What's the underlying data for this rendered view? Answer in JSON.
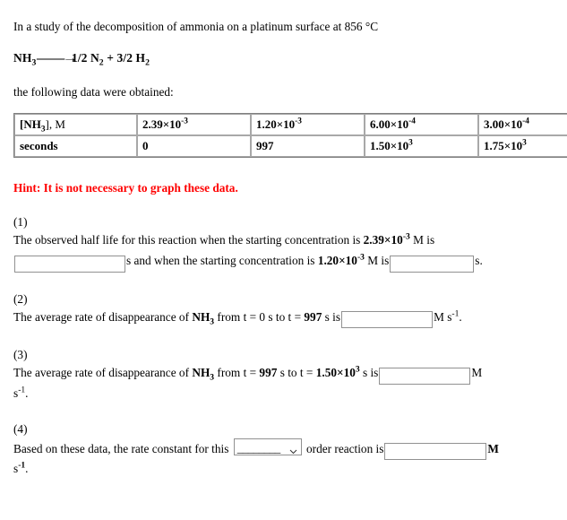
{
  "problem": {
    "intro": "In a study of the decomposition of ammonia on a platinum surface at 856 °C",
    "equation": {
      "reactant": "NH",
      "reactant_sub": "3",
      "arrow": "——→",
      "product_1_coef": "1/2 N",
      "product_1_sub": "2",
      "plus": " + ",
      "product_2_coef": "3/2 H",
      "product_2_sub": "2"
    },
    "lead_in": "the following data were obtained:",
    "hint": "Hint: It is not necessary to graph these data."
  },
  "table": {
    "rows": [
      {
        "label": "[NH",
        "label_sub": "3",
        "label_rest": "], M",
        "values": [
          {
            "mantissa": "2.39×10",
            "exp": "-3"
          },
          {
            "mantissa": "1.20×10",
            "exp": "-3"
          },
          {
            "mantissa": "6.00×10",
            "exp": "-4"
          },
          {
            "mantissa": "3.00×10",
            "exp": "-4"
          }
        ]
      },
      {
        "label": "seconds",
        "label_sub": "",
        "label_rest": "",
        "values": [
          {
            "mantissa": "0",
            "exp": ""
          },
          {
            "mantissa": "997",
            "exp": ""
          },
          {
            "mantissa": "1.50×10",
            "exp": "3"
          },
          {
            "mantissa": "1.75×10",
            "exp": "3"
          }
        ]
      }
    ]
  },
  "questions": [
    {
      "number": "(1)",
      "part_a": "The observed half life for this reaction when the starting concentration is ",
      "conc_1_mantissa": "2.39×10",
      "conc_1_exp": "-3",
      "part_b": " M is",
      "unit_a": "s and when the starting concentration is ",
      "conc_2_mantissa": "1.20×10",
      "conc_2_exp": "-3",
      "part_c": " M is",
      "unit_b": "s.",
      "input_1_value": "",
      "input_2_value": ""
    },
    {
      "number": "(2)",
      "part_a": "The average rate of disappearance of ",
      "species": "NH",
      "species_sub": "3",
      "part_b": " from t = 0 s to t = ",
      "time_bold": "997",
      "part_c": " s is",
      "unit_mantissa": "M s",
      "unit_exp": "-1",
      "unit_tail": ".",
      "input_value": ""
    },
    {
      "number": "(3)",
      "part_a": "The average rate of disappearance of ",
      "species": "NH",
      "species_sub": "3",
      "part_b": " from t = ",
      "time_1": "997",
      "part_c": " s to t = ",
      "time_2_mantissa": "1.50×10",
      "time_2_exp": "3",
      "part_d": " s is",
      "unit_head": "M",
      "unit_wrap_mantissa": "s",
      "unit_wrap_exp": "-1",
      "unit_wrap_tail": ".",
      "input_value": ""
    },
    {
      "number": "(4)",
      "part_a": "Based on these data, the rate constant for this ",
      "select_value": "________",
      "part_b": " order reaction is",
      "unit_head": "M",
      "unit_wrap_mantissa": "s",
      "unit_wrap_exp": "-1",
      "unit_wrap_tail": ".",
      "input_value": ""
    }
  ],
  "colors": {
    "hint": "#ff0000",
    "input_border": "#919191",
    "table_border": "#808080",
    "cell_border": "#a8a8a8",
    "text": "#000000",
    "background": "#ffffff"
  }
}
